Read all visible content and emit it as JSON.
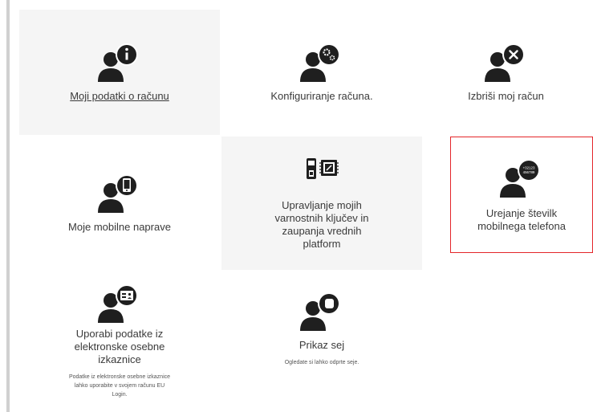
{
  "tiles": [
    {
      "label": "Moji podatki o računu",
      "icon": "user-info-icon"
    },
    {
      "label": "Konfiguriranje računa.",
      "icon": "user-settings-icon"
    },
    {
      "label": "Izbriši moj račun",
      "icon": "user-delete-icon"
    },
    {
      "label": "Moje mobilne naprave",
      "icon": "user-mobile-icon"
    },
    {
      "label": "Upravljanje mojih varnostnih ključev in zaupanja vrednih platform",
      "icon": "security-keys-icon"
    },
    {
      "label": "Urejanje številk mobilnega telefona",
      "icon": "user-phone-numbers-icon",
      "badge_text": "+32123 456789"
    },
    {
      "label": "Uporabi podatke iz elektronske osebne izkaznice",
      "description": "Podatke iz elektronske osebne izkaznice lahko uporabite v svojem računu EU Login.",
      "icon": "user-eid-icon"
    },
    {
      "label": "Prikaz sej",
      "description": "Ogledate si lahko odprte seje.",
      "icon": "user-sessions-icon"
    }
  ],
  "colors": {
    "icon": "#1f1f1f",
    "highlight_border": "#e4262a",
    "tile_bg": "#f5f5f5"
  }
}
